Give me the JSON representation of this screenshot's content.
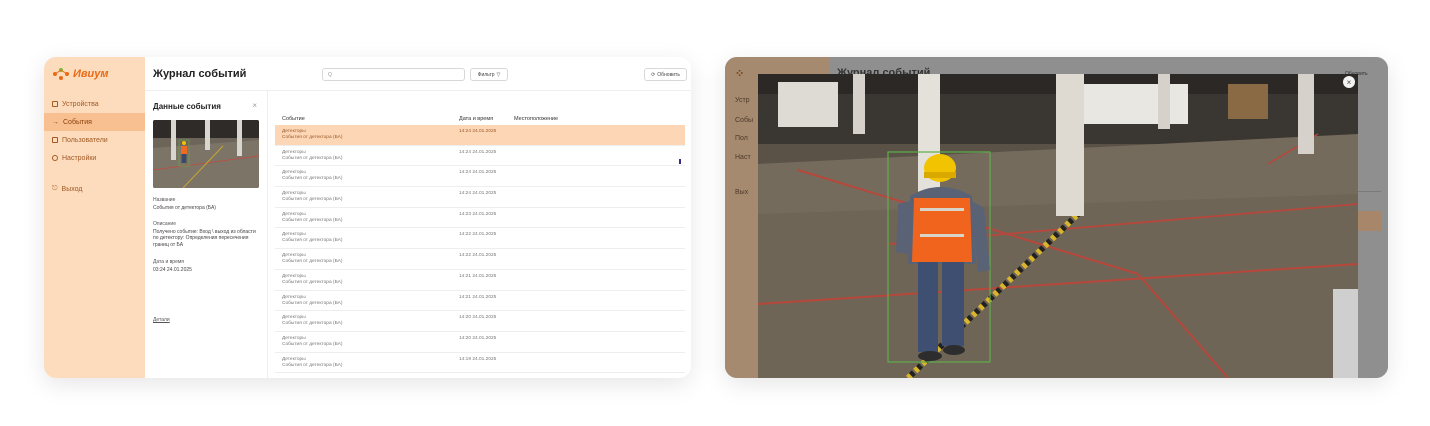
{
  "app": {
    "logo_text": "Ивиум",
    "nav": [
      {
        "label": "Устройства",
        "icon": "device-icon",
        "active": false
      },
      {
        "label": "События",
        "icon": "events-arrow-icon",
        "active": true
      },
      {
        "label": "Пользователи",
        "icon": "users-icon",
        "active": false
      },
      {
        "label": "Настройки",
        "icon": "settings-gear-icon",
        "active": false
      }
    ],
    "logout_label": "Выход"
  },
  "header": {
    "title": "Журнал событий",
    "search_placeholder": "Q",
    "filter_label": "Фильтр",
    "refresh_label": "Обновить"
  },
  "detail": {
    "title": "Данные события",
    "name_label": "Название",
    "name_value": "События от детектора (БА)",
    "desc_label": "Описание",
    "desc_value": "Получено событие: Вход \\ выход из области по детектору: Определения пересечения границ от БА",
    "datetime_label": "Дата и время",
    "datetime_value": "03:24 24.01.2025",
    "details_link": "Детали"
  },
  "table": {
    "columns": [
      "Событие",
      "Дата и время",
      "Местоположение"
    ],
    "rows": [
      {
        "type": "Детекторы",
        "desc": "События от детектора (БА)",
        "datetime": "14:24 24.01.2025",
        "selected": true
      },
      {
        "type": "Детекторы",
        "desc": "События от детектора (БА)",
        "datetime": "14:24 24.01.2025",
        "selected": false
      },
      {
        "type": "Детекторы",
        "desc": "События от детектора (БА)",
        "datetime": "14:24 24.01.2025",
        "selected": false
      },
      {
        "type": "Детекторы",
        "desc": "События от детектора (БА)",
        "datetime": "14:24 24.01.2025",
        "selected": false
      },
      {
        "type": "Детекторы",
        "desc": "События от детектора (БА)",
        "datetime": "14:23 24.01.2025",
        "selected": false
      },
      {
        "type": "Детекторы",
        "desc": "События от детектора (БА)",
        "datetime": "14:22 24.01.2025",
        "selected": false
      },
      {
        "type": "Детекторы",
        "desc": "События от детектора (БА)",
        "datetime": "14:22 24.01.2025",
        "selected": false
      },
      {
        "type": "Детекторы",
        "desc": "События от детектора (БА)",
        "datetime": "14:21 24.01.2025",
        "selected": false
      },
      {
        "type": "Детекторы",
        "desc": "События от детектора (БА)",
        "datetime": "14:21 24.01.2025",
        "selected": false
      },
      {
        "type": "Детекторы",
        "desc": "События от детектора (БА)",
        "datetime": "14:20 24.01.2025",
        "selected": false
      },
      {
        "type": "Детекторы",
        "desc": "События от детектора (БА)",
        "datetime": "14:20 24.01.2025",
        "selected": false
      },
      {
        "type": "Детекторы",
        "desc": "События от детектора (БА)",
        "datetime": "14:19 24.01.2025",
        "selected": false
      }
    ]
  },
  "overlay": {
    "bg_title": "Журнал событий",
    "bg_nav": [
      "Устр",
      "Собы",
      "Пол",
      "Наст",
      "Вых"
    ],
    "bg_refresh": "Обновить",
    "close_symbol": "×"
  },
  "colors": {
    "accent": "#e96a17",
    "sidebar_bg": "#fcdcbd",
    "selected_row": "#fcd6b5",
    "detection_box": "#5fae4a"
  }
}
